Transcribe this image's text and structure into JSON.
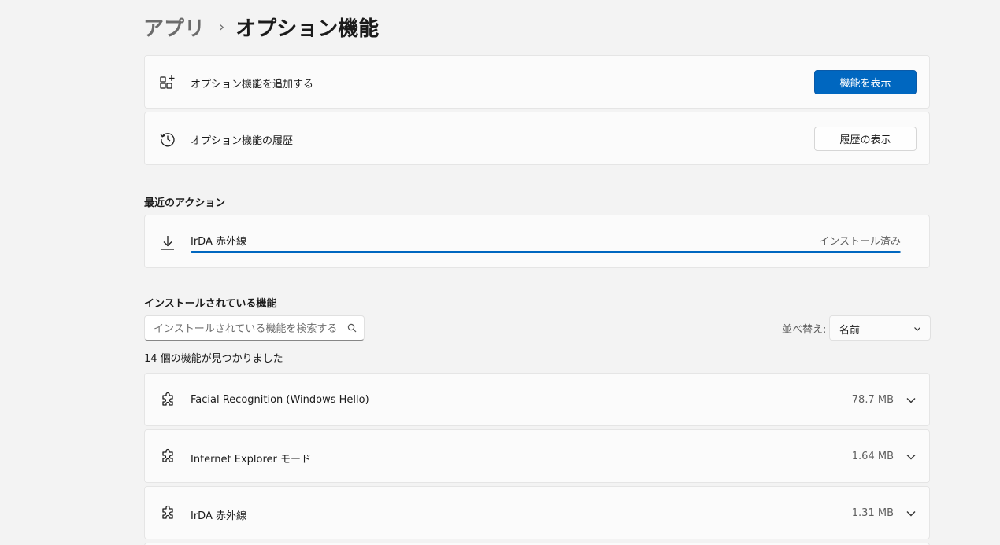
{
  "breadcrumb": {
    "parent": "アプリ",
    "separator": "›",
    "current": "オプション機能"
  },
  "add_feature": {
    "icon": "add-apps-icon",
    "label": "オプション機能を追加する",
    "button": "機能を表示"
  },
  "history": {
    "icon": "history-icon",
    "label": "オプション機能の履歴",
    "button": "履歴の表示"
  },
  "recent_actions": {
    "title": "最近のアクション",
    "item": {
      "icon": "download-icon",
      "name": "IrDA 赤外線",
      "status": "インストール済み",
      "progress": 1.0
    }
  },
  "installed": {
    "title": "インストールされている機能",
    "search_placeholder": "インストールされている機能を検索する",
    "sort_label": "並べ替え:",
    "sort_value": "名前",
    "count_text": "14 個の機能が見つかりました",
    "features": [
      {
        "name": "Facial Recognition (Windows Hello)",
        "size": "78.7 MB",
        "icon": "puzzle-icon"
      },
      {
        "name": "Internet Explorer モード",
        "size": "1.64 MB",
        "icon": "puzzle-icon"
      },
      {
        "name": "IrDA 赤外線",
        "size": "1.31 MB",
        "icon": "puzzle-icon"
      }
    ]
  },
  "colors": {
    "accent": "#0067c0",
    "background": "#f3f3f3",
    "card": "#fbfbfb"
  }
}
